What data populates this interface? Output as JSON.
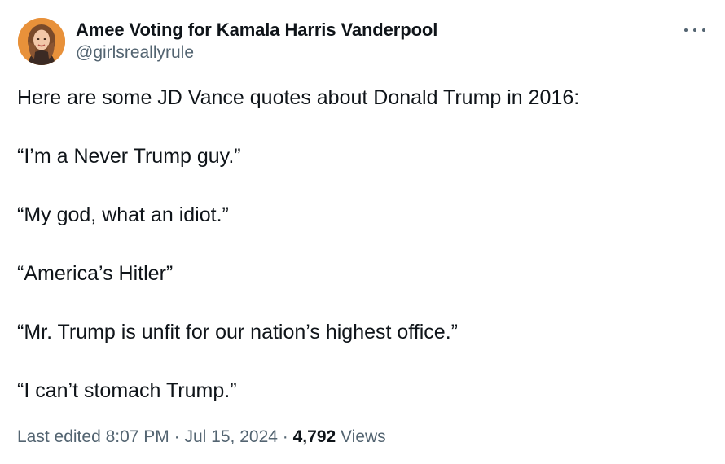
{
  "author": {
    "display_name": "Amee Voting for Kamala Harris Vanderpool",
    "handle": "@girlsreallyrule"
  },
  "tweet": {
    "paragraphs": [
      "Here are some JD Vance quotes about Donald Trump in 2016:",
      "“I’m a Never Trump guy.”",
      "“My god, what an idiot.”",
      "“America’s Hitler”",
      "“Mr. Trump is unfit for our nation’s highest office.”",
      "“I can’t stomach Trump.”"
    ]
  },
  "meta": {
    "edited_label": "Last edited",
    "time": "8:07 PM",
    "separator": "·",
    "date": "Jul 15, 2024",
    "views_count": "4,792",
    "views_label": "Views"
  },
  "colors": {
    "text_primary": "#0f1419",
    "text_secondary": "#536471",
    "avatar_bg": "#e8913a"
  },
  "icons": {
    "more": "more-horizontal-icon"
  }
}
